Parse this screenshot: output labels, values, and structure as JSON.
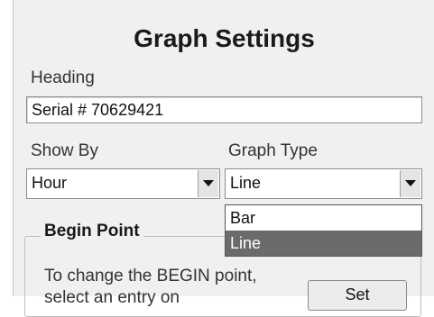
{
  "dialog": {
    "title": "Graph Settings"
  },
  "heading": {
    "label": "Heading",
    "value": "Serial # 70629421"
  },
  "show_by": {
    "label": "Show By",
    "selected": "Hour"
  },
  "graph_type": {
    "label": "Graph Type",
    "selected": "Line",
    "options": [
      "Bar",
      "Line"
    ],
    "highlighted_option": "Line"
  },
  "begin_point": {
    "group_title": "Begin Point",
    "help_text": "To change the BEGIN point, select an entry on",
    "set_button_label": "Set"
  },
  "colors": {
    "window_bg": "#f0f0f0",
    "selection_bg": "#6b6b6b",
    "selection_text": "#ffffff"
  },
  "icons": {
    "combo_arrow": "chevron-down-icon"
  }
}
